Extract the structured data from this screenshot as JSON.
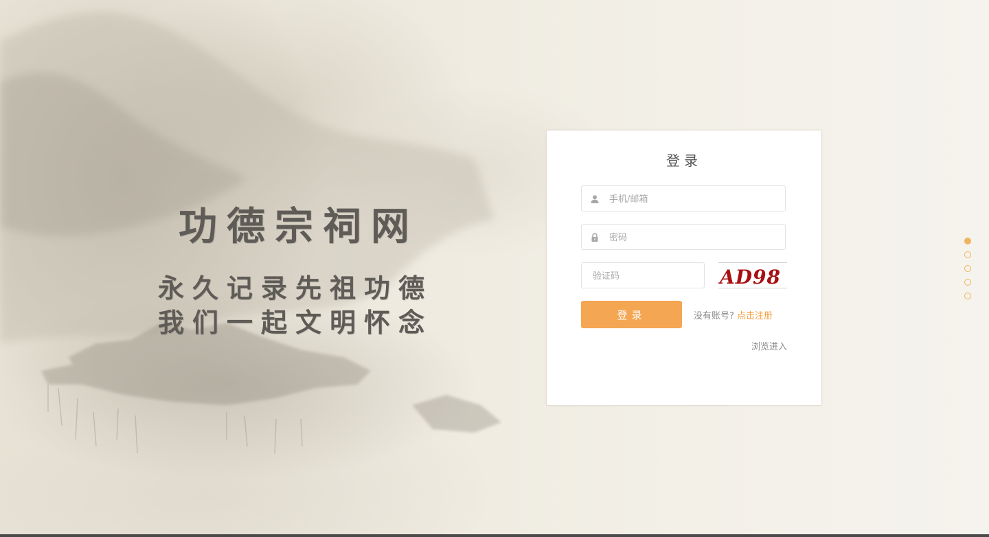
{
  "brand": {
    "title": "功德宗祠网",
    "line1": "永久记录先祖功德",
    "line2": "我们一起文明怀念"
  },
  "login": {
    "title": "登录",
    "username": {
      "placeholder": "手机/邮箱",
      "value": "",
      "icon": "user-icon"
    },
    "password": {
      "placeholder": "密码",
      "value": "",
      "icon": "lock-icon"
    },
    "captcha": {
      "placeholder": "验证码",
      "value": "",
      "image_text": "AD98"
    },
    "submit_label": "登录",
    "no_account_text": "没有账号?",
    "register_link": "点击注册",
    "browse_link": "浏览进入"
  },
  "pagination": {
    "count": 5,
    "active_index": 0
  },
  "colors": {
    "accent": "#f5a652",
    "link": "#f39b3c",
    "captcha_text": "#a80f12"
  }
}
